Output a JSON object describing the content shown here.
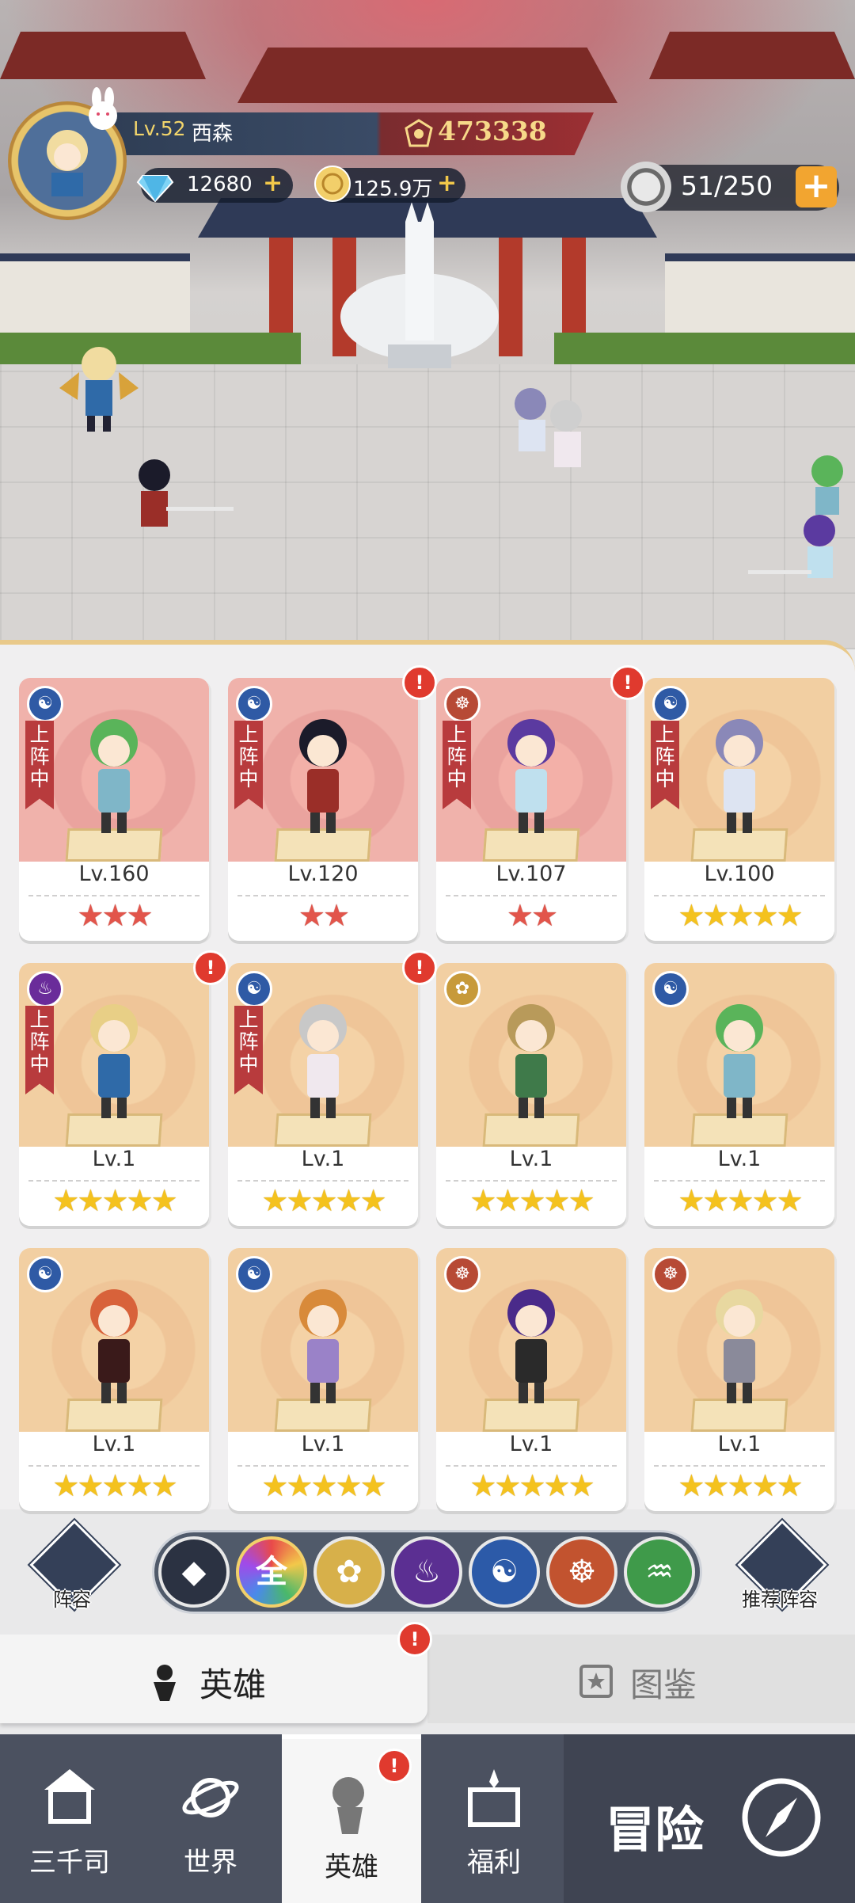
{
  "player": {
    "level": "Lv.52",
    "name": "西森",
    "power": "473338",
    "diamonds": "12680",
    "gold": "125.9万",
    "stamina": "51/250"
  },
  "heroes": [
    {
      "level": "Lv.160",
      "stars": 3,
      "star_color": "red",
      "element": "water",
      "deployed": true,
      "alert": false,
      "tone": "red"
    },
    {
      "level": "Lv.120",
      "stars": 2,
      "star_color": "red",
      "element": "water",
      "deployed": true,
      "alert": true,
      "tone": "red"
    },
    {
      "level": "Lv.107",
      "stars": 2,
      "star_color": "red",
      "element": "monk",
      "deployed": true,
      "alert": true,
      "tone": "red"
    },
    {
      "level": "Lv.100",
      "stars": 5,
      "star_color": "gold",
      "element": "water",
      "deployed": true,
      "alert": false,
      "tone": "gold"
    },
    {
      "level": "Lv.1",
      "stars": 5,
      "star_color": "gold",
      "element": "fire",
      "deployed": true,
      "alert": true,
      "tone": "gold"
    },
    {
      "level": "Lv.1",
      "stars": 5,
      "star_color": "gold",
      "element": "water",
      "deployed": true,
      "alert": true,
      "tone": "gold"
    },
    {
      "level": "Lv.1",
      "stars": 5,
      "star_color": "gold",
      "element": "light",
      "deployed": false,
      "alert": false,
      "tone": "gold"
    },
    {
      "level": "Lv.1",
      "stars": 5,
      "star_color": "gold",
      "element": "water",
      "deployed": false,
      "alert": false,
      "tone": "gold"
    },
    {
      "level": "Lv.1",
      "stars": 5,
      "star_color": "gold",
      "element": "water",
      "deployed": false,
      "alert": false,
      "tone": "gold"
    },
    {
      "level": "Lv.1",
      "stars": 5,
      "star_color": "gold",
      "element": "water",
      "deployed": false,
      "alert": false,
      "tone": "gold"
    },
    {
      "level": "Lv.1",
      "stars": 5,
      "star_color": "gold",
      "element": "monk",
      "deployed": false,
      "alert": false,
      "tone": "gold"
    },
    {
      "level": "Lv.1",
      "stars": 5,
      "star_color": "gold",
      "element": "monk",
      "deployed": false,
      "alert": false,
      "tone": "gold"
    }
  ],
  "deployed_label": "上阵中",
  "filters": {
    "lineup_label": "阵容",
    "recommend_label": "推荐阵容",
    "all_label": "全"
  },
  "tabs": {
    "heroes": "英雄",
    "codex": "图鉴"
  },
  "nav": {
    "home": "三千司",
    "world": "世界",
    "heroes": "英雄",
    "welfare": "福利",
    "adventure": "冒险"
  },
  "colors": {
    "panel": "#f0eff0",
    "alert": "#e03a2e",
    "deployed_banner": "#b83b3d",
    "nav_bg": "#4b5160"
  }
}
